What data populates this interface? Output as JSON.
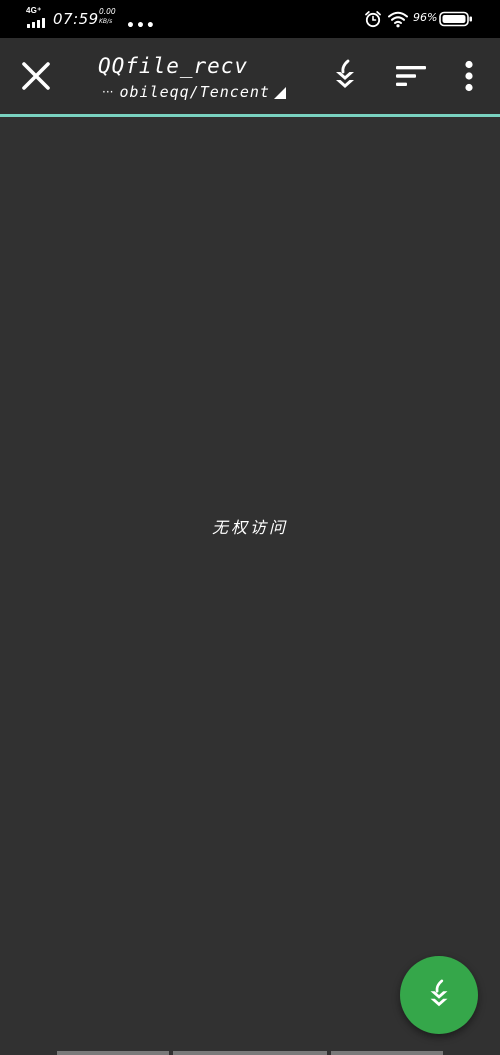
{
  "status_bar": {
    "network_type": "4G⁺",
    "time": "07:59",
    "net_speed_value": "0.00",
    "net_speed_unit": "KB/s",
    "more_indicator": "•••",
    "battery_percent": "96%"
  },
  "toolbar": {
    "folder_title": "QQfile_recv",
    "path_ellipsis": "···",
    "folder_path": "obileqq/Tencent",
    "accent_color": "#79d2c0"
  },
  "content": {
    "empty_message": "无权访问"
  },
  "fab": {
    "color": "#35a74a",
    "icon": "download-arrow-icon"
  },
  "icons": {
    "close": "close-icon",
    "download": "download-arrow-icon",
    "sort": "sort-icon",
    "overflow": "more-vert-icon",
    "path_dropdown": "dropdown-triangle-icon"
  }
}
